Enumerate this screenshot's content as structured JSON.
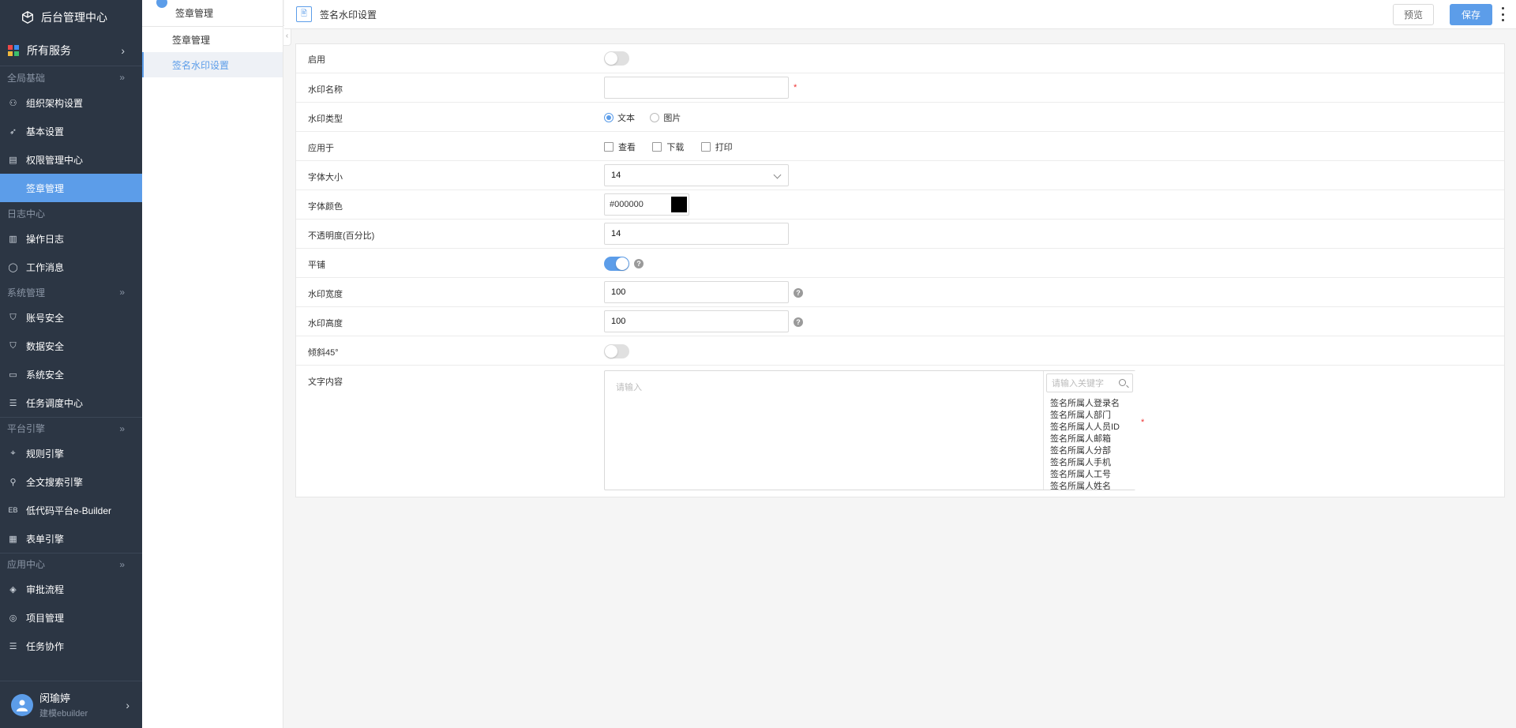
{
  "brand": {
    "title": "后台管理中心"
  },
  "sidebar": {
    "all_services": "所有服务",
    "groups": [
      {
        "title": "全局基础",
        "items": [
          "组织架构设置",
          "基本设置",
          "权限管理中心",
          "签章管理"
        ]
      },
      {
        "title": "日志中心",
        "items": [
          "操作日志",
          "工作消息"
        ]
      },
      {
        "title": "系统管理",
        "items": [
          "账号安全",
          "数据安全",
          "系统安全",
          "任务调度中心"
        ]
      },
      {
        "title": "平台引擎",
        "items": [
          "规则引擎",
          "全文搜索引擎",
          "低代码平台e-Builder",
          "表单引擎"
        ]
      },
      {
        "title": "应用中心",
        "items": [
          "审批流程",
          "项目管理",
          "任务协作"
        ]
      }
    ],
    "active_item": "签章管理",
    "user": {
      "name": "闵瑜婷",
      "sub": "建模ebuilder"
    }
  },
  "subnav": {
    "title": "签章管理",
    "items": [
      "签章管理",
      "签名水印设置"
    ],
    "active": "签名水印设置"
  },
  "header": {
    "page_icon_glyph": "🖹",
    "title": "签名水印设置",
    "preview_label": "预览",
    "save_label": "保存"
  },
  "form": {
    "enable": {
      "label": "启用",
      "value": false
    },
    "name": {
      "label": "水印名称",
      "value": "",
      "required_mark": "*"
    },
    "type": {
      "label": "水印类型",
      "options": [
        "文本",
        "图片"
      ],
      "selected": "文本"
    },
    "apply_to": {
      "label": "应用于",
      "options": [
        "查看",
        "下载",
        "打印"
      ]
    },
    "font_size": {
      "label": "字体大小",
      "value": "14"
    },
    "font_color": {
      "label": "字体颜色",
      "value": "#000000"
    },
    "opacity": {
      "label": "不透明度(百分比)",
      "value": "14"
    },
    "tile": {
      "label": "平铺",
      "value": true
    },
    "width": {
      "label": "水印宽度",
      "value": "100"
    },
    "height": {
      "label": "水印高度",
      "value": "100"
    },
    "tilt": {
      "label": "倾斜45°",
      "value": false
    },
    "text_content": {
      "label": "文字内容",
      "placeholder": "请输入",
      "keyword_placeholder": "请输入关键字",
      "keywords": [
        "签名所属人登录名",
        "签名所属人部门",
        "签名所属人人员ID",
        "签名所属人邮箱",
        "签名所属人分部",
        "签名所属人手机",
        "签名所属人工号",
        "签名所属人姓名"
      ],
      "required_mark": "*"
    },
    "help_glyph": "?"
  },
  "colors": {
    "accent": "#5c9de9",
    "sidebar_bg": "#2c3644",
    "required": "#e33333"
  }
}
